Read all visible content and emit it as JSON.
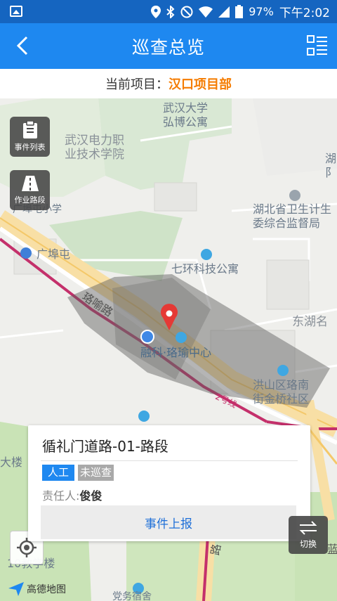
{
  "status_bar": {
    "battery": "97%",
    "time": "下午2:02"
  },
  "app_bar": {
    "title": "巡查总览"
  },
  "project": {
    "label": "当前项目：",
    "name": "汉口项目部"
  },
  "map": {
    "labels": {
      "whut": "武汉大学\n弘博公寓",
      "power_college": "武汉电力职\n业技术学院",
      "hubei_cut": "湖\n阝",
      "primary_school": "广埠屯小学",
      "health": "湖北省卫生计生\n委综合监督局",
      "guangbutun": "广埠屯",
      "qihuan": "七环科技公寓",
      "luoyu_road": "珞喻路",
      "donghu": "东湖名",
      "rongke": "融科·珞瑜中心",
      "hongshan": "洪山区珞南\n街金桥社区",
      "line2": "2号线",
      "daylou": "大楼",
      "teaching": "10教学楼",
      "road_cut": "路",
      "lan_cut": "蓝",
      "bottom_cut": "党务宿舍"
    },
    "event_list": "事件列表",
    "work_path": "作业路段",
    "switch": "切换",
    "logo": "高德地图"
  },
  "card": {
    "road_name": "循礼门道路-01-路段",
    "tag_mode": "人工",
    "tag_status": "未巡查",
    "person_label": "责任人:",
    "person_name": "俊俊",
    "report_button": "事件上报"
  },
  "colors": {
    "primary": "#1e88f0",
    "accent": "#f57c00"
  }
}
